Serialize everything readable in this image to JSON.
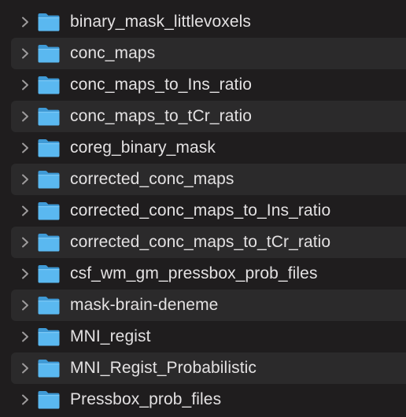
{
  "colors": {
    "background": "#1f1d1e",
    "row_alt": "#2b2a2b",
    "text": "#e3e1e2",
    "folder_front": "#5ab8f0",
    "folder_back": "#3f9ad6",
    "chevron": "#9d9b9c"
  },
  "icons": {
    "expander": "chevron-right-icon",
    "item": "folder-icon"
  },
  "items": [
    {
      "label": "binary_mask_littlevoxels"
    },
    {
      "label": "conc_maps"
    },
    {
      "label": "conc_maps_to_Ins_ratio"
    },
    {
      "label": "conc_maps_to_tCr_ratio"
    },
    {
      "label": "coreg_binary_mask"
    },
    {
      "label": "corrected_conc_maps"
    },
    {
      "label": "corrected_conc_maps_to_Ins_ratio"
    },
    {
      "label": "corrected_conc_maps_to_tCr_ratio"
    },
    {
      "label": "csf_wm_gm_pressbox_prob_files"
    },
    {
      "label": "mask-brain-deneme"
    },
    {
      "label": "MNI_regist"
    },
    {
      "label": "MNI_Regist_Probabilistic"
    },
    {
      "label": "Pressbox_prob_files"
    }
  ]
}
